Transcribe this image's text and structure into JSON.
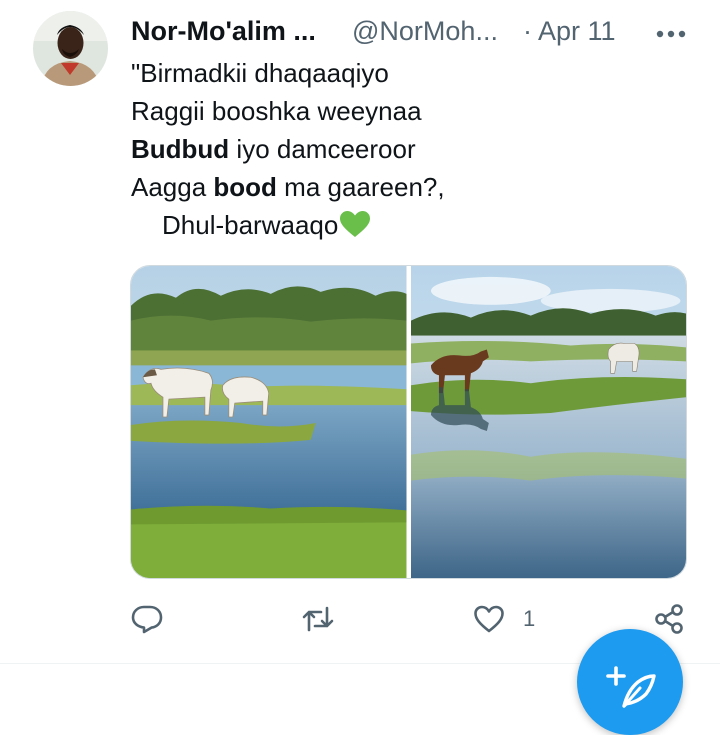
{
  "tweet": {
    "author_name": "Nor-Mo'alim ...",
    "handle": "@NorMoh...",
    "separator_date": "· Apr 11",
    "lines": [
      {
        "pre": "\"Birmadkii dhaqaaqiyo",
        "bold": "",
        "post": ""
      },
      {
        "pre": "Raggii booshka weeynaa",
        "bold": "",
        "post": ""
      },
      {
        "pre": "",
        "bold": "Budbud",
        "post": " iyo damceeroor"
      },
      {
        "pre": "Aagga ",
        "bold": "bood",
        "post": " ma gaareen?,"
      },
      {
        "pre": "Dhul-barwaaqo",
        "bold": "",
        "post": ""
      }
    ],
    "emoji": "green-heart",
    "media": [
      "two-horses-at-lake-photo",
      "horses-in-wetland-photo"
    ]
  },
  "actions": {
    "reply_icon": "reply-icon",
    "retweet_icon": "retweet-icon",
    "like_icon": "heart-icon",
    "like_count": "1",
    "share_icon": "share-icon"
  },
  "fab": {
    "icon": "compose-icon"
  },
  "colors": {
    "text": "#0f1419",
    "secondary": "#536471",
    "accent": "#1d9bf0",
    "emoji_green": "#6abf4b",
    "divider": "#eff3f4"
  }
}
